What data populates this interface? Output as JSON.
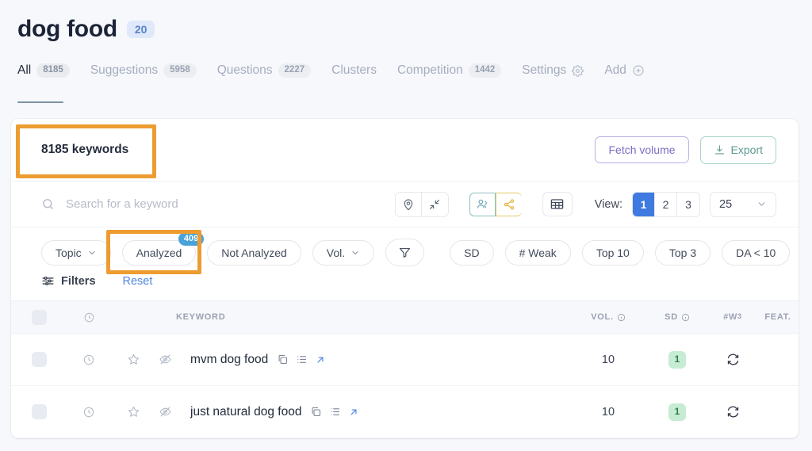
{
  "header": {
    "title": "dog food",
    "badge": "20"
  },
  "tabs": [
    {
      "label": "All",
      "count": "8185",
      "active": true,
      "icon": ""
    },
    {
      "label": "Suggestions",
      "count": "5958",
      "active": false,
      "icon": ""
    },
    {
      "label": "Questions",
      "count": "2227",
      "active": false,
      "icon": ""
    },
    {
      "label": "Clusters",
      "count": "",
      "active": false,
      "icon": ""
    },
    {
      "label": "Competition",
      "count": "1442",
      "active": false,
      "icon": ""
    },
    {
      "label": "Settings",
      "count": "",
      "active": false,
      "icon": "gear-icon"
    },
    {
      "label": "Add",
      "count": "",
      "active": false,
      "icon": "plus-circle-icon"
    }
  ],
  "card_top": {
    "keyword_count": "8185 keywords",
    "fetch_volume_label": "Fetch volume",
    "export_label": "Export"
  },
  "search": {
    "placeholder": "Search for a keyword",
    "icon": "search-icon"
  },
  "toolbar_icons": {
    "location_icon": "map-pin-icon",
    "collapse_icon": "collapse-arrows-icon",
    "people_icon": "people-icon",
    "share_icon": "share-nodes-icon",
    "table_icon": "table-grid-icon"
  },
  "view": {
    "label": "View:",
    "pages": [
      "1",
      "2",
      "3"
    ],
    "selected_page": "1",
    "per_page": "25"
  },
  "filters": {
    "chips": [
      {
        "label": "Topic",
        "caret": true,
        "badge": ""
      },
      {
        "label": "Analyzed",
        "caret": false,
        "badge": "409"
      },
      {
        "label": "Not Analyzed",
        "caret": false,
        "badge": ""
      },
      {
        "label": "Vol.",
        "caret": true,
        "badge": ""
      }
    ],
    "funnel_icon": "filter-funnel-icon",
    "chips_right": [
      {
        "label": "SD"
      },
      {
        "label": "# Weak"
      },
      {
        "label": "Top 10"
      },
      {
        "label": "Top 3"
      },
      {
        "label": "DA < 10"
      }
    ],
    "filters_label": "Filters",
    "filters_icon": "sliders-icon",
    "reset_label": "Reset"
  },
  "table": {
    "headers": {
      "keyword": "KEYWORD",
      "vol": "VOL.",
      "sd": "SD",
      "weak": "#W",
      "weak_sup": "3",
      "feat": "FEAT.",
      "clock_icon": "clock-icon"
    },
    "rows": [
      {
        "keyword": "mvm dog food",
        "vol": "10",
        "sd": "1",
        "icons": [
          "clock-icon",
          "star-icon",
          "eye-off-icon"
        ],
        "trailing_icons": [
          "copy-icon",
          "list-icon",
          "external-link-icon"
        ],
        "refresh_icon": "refresh-icon"
      },
      {
        "keyword": "just natural dog food",
        "vol": "10",
        "sd": "1",
        "icons": [
          "clock-icon",
          "star-icon",
          "eye-off-icon"
        ],
        "trailing_icons": [
          "copy-icon",
          "list-icon",
          "external-link-icon"
        ],
        "refresh_icon": "refresh-icon"
      }
    ]
  },
  "annotations": {
    "highlight_color": "#ed9c31",
    "boxes": [
      "keyword-count-highlight",
      "analyzed-chip-highlight"
    ]
  }
}
